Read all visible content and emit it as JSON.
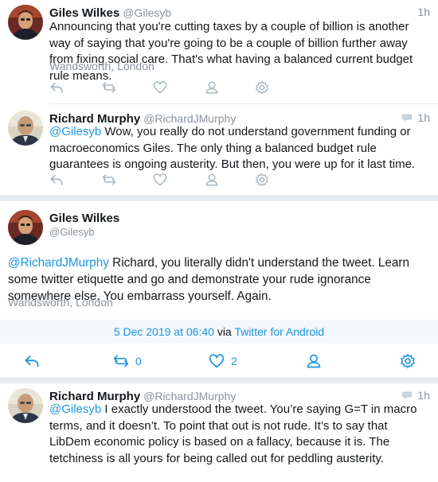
{
  "tweet1": {
    "name": "Giles Wilkes",
    "handle": "@Gilesyb",
    "time": "1h",
    "text": "Announcing that you're cutting taxes by a couple of billion is another way of saying that you're going to be a couple of billion further away from fixing social care. That's what having a balanced current budget rule means.",
    "location": "Wandsworth, London"
  },
  "tweet2": {
    "name": "Richard Murphy",
    "handle": "@RichardJMurphy",
    "time": "1h",
    "mention": "@Gilesyb",
    "text": " Wow, you really do not understand government funding or macroeconomics Giles. The only thing a balanced budget rule guarantees is ongoing austerity. But then, you were up for it last time."
  },
  "focus": {
    "name": "Giles Wilkes",
    "handle": "@Gilesyb",
    "mention": "@RichardJMurphy",
    "text": " Richard, you literally didn't understand the tweet. Learn some twitter etiquette and go and demonstrate your rude ignorance somewhere else. You embarrass yourself. Again.",
    "location": "Wandsworth, London",
    "date": "5 Dec 2019 at 06:40",
    "via_label": "via",
    "source": "Twitter for Android",
    "retweets": "0",
    "likes": "2"
  },
  "tweet3": {
    "name": "Richard Murphy",
    "handle": "@RichardJMurphy",
    "time": "1h",
    "mention": "@Gilesyb",
    "text": " I exactly understood the tweet. You’re saying G=T in macro terms, and it doesn’t. To point that out is not rude. It’s to say that LibDem economic policy is based on a fallacy, because it is. The tetchiness is all yours for being called out for peddling austerity."
  },
  "icons": {
    "reply": "reply-icon",
    "retweet": "retweet-icon",
    "like": "heart-icon",
    "profile": "person-icon",
    "settings": "gear-icon",
    "in_reply": "speech-bubble-icon"
  },
  "colors": {
    "link": "#1b95e0",
    "muted": "#8a939b",
    "action_gray": "#aab8c2",
    "band": "#e6ecf0",
    "meta_bg": "#f3f8fc"
  }
}
